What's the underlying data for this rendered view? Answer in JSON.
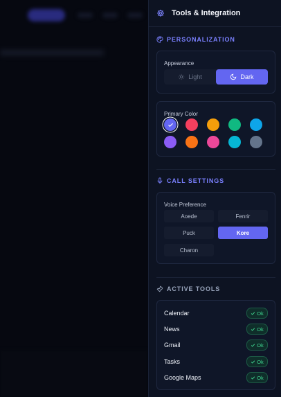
{
  "panel": {
    "title": "Tools & Integration"
  },
  "personalization": {
    "title": "PERSONALIZATION",
    "appearance": {
      "label": "Appearance",
      "light": "Light",
      "dark": "Dark",
      "selected": "dark"
    },
    "primary_color": {
      "label": "Primary Color",
      "colors": [
        "#6366f1",
        "#f43f5e",
        "#f59e0b",
        "#10b981",
        "#0ea5e9",
        "#8b5cf6",
        "#f97316",
        "#ec4899",
        "#06b6d4",
        "#64748b"
      ],
      "selected_index": 0
    }
  },
  "call_settings": {
    "title": "CALL SETTINGS",
    "voice": {
      "label": "Voice Preference",
      "options": [
        "Aoede",
        "Fenrir",
        "Puck",
        "Kore",
        "Charon"
      ],
      "selected": "Kore"
    }
  },
  "active_tools": {
    "title": "ACTIVE TOOLS",
    "items": [
      {
        "name": "Calendar",
        "status": "Ok"
      },
      {
        "name": "News",
        "status": "Ok"
      },
      {
        "name": "Gmail",
        "status": "Ok"
      },
      {
        "name": "Tasks",
        "status": "Ok"
      },
      {
        "name": "Google Maps",
        "status": "Ok"
      }
    ]
  }
}
